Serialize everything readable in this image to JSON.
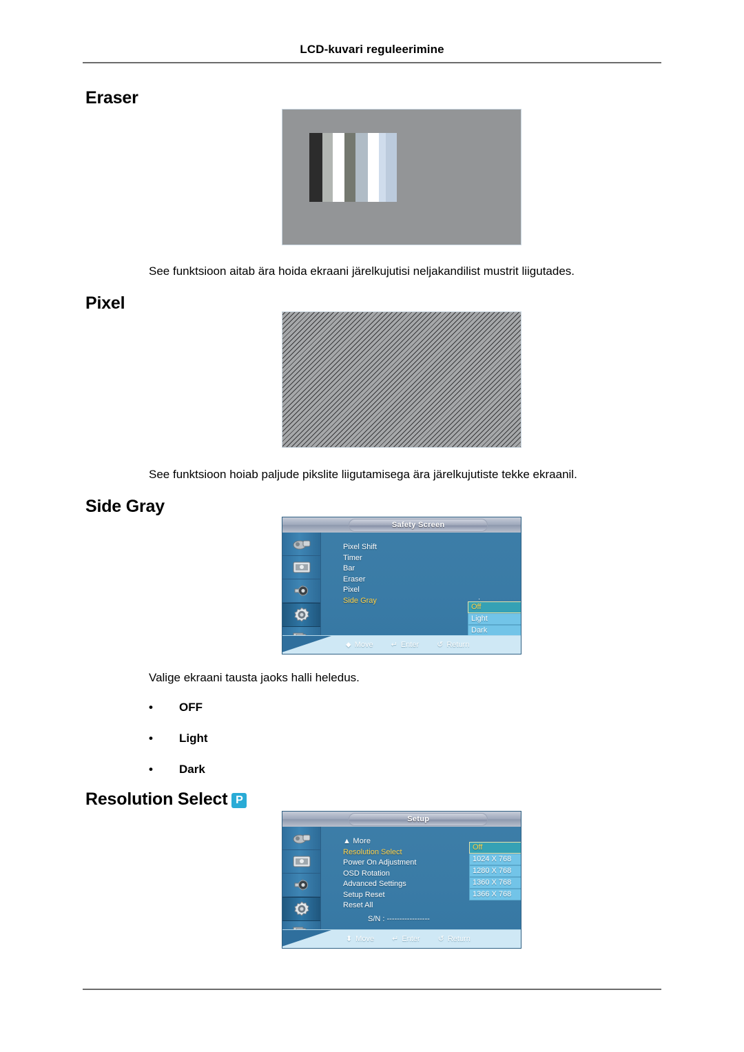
{
  "header": {
    "running_title": "LCD-kuvari reguleerimine"
  },
  "sections": {
    "eraser": {
      "title": "Eraser",
      "description": "See funktsioon aitab ära hoida ekraani järelkujutisi neljakandilist mustrit liigutades.",
      "figure": {
        "name": "eraser-pattern-image",
        "background_color": "#939597",
        "bar_colors": [
          "#2c2c2c",
          "#b2b6b2",
          "#ffffff",
          "#74786f",
          "#b0bcc6",
          "#ffffff",
          "#cfdcec",
          "#bccbdd"
        ]
      }
    },
    "pixel": {
      "title": "Pixel",
      "description": "See funktsioon hoiab paljude pikslite liigutamisega ära järelkujutiste tekke ekraanil.",
      "figure": {
        "name": "pixel-pattern-image",
        "background_color": "#a6a8aa",
        "hatch_color": "#323234"
      }
    },
    "side_gray": {
      "title": "Side Gray",
      "description": "Valige ekraani tausta jaoks halli heledus.",
      "bullets": [
        "OFF",
        "Light",
        "Dark"
      ],
      "osd": {
        "name": "safety-screen-osd",
        "title": "Safety Screen",
        "menu_items": [
          {
            "label": "Pixel Shift",
            "active": false,
            "colon": false
          },
          {
            "label": "Timer",
            "active": false,
            "colon": false
          },
          {
            "label": "Bar",
            "active": false,
            "colon": false
          },
          {
            "label": "Eraser",
            "active": false,
            "colon": false
          },
          {
            "label": "Pixel",
            "active": false,
            "colon": false
          },
          {
            "label": "Side Gray",
            "active": true,
            "colon": true
          }
        ],
        "dropdown": {
          "options": [
            "Off",
            "Light",
            "Dark"
          ],
          "selected": "Off"
        },
        "hints": [
          {
            "icon": "move-icon",
            "glyph": "⬥",
            "label": "Move"
          },
          {
            "icon": "enter-icon",
            "glyph": "↵",
            "label": "Enter"
          },
          {
            "icon": "return-icon",
            "glyph": "↺",
            "label": "Return"
          }
        ],
        "sidebar_icons": [
          "input-source-icon",
          "picture-icon",
          "sound-icon",
          "setup-gear-icon",
          "multi-control-icon"
        ],
        "selected_sidebar_index": 3
      }
    },
    "resolution_select": {
      "title": "Resolution Select",
      "badge": "P",
      "badge_color": "#29abd6",
      "osd": {
        "name": "setup-osd",
        "title": "Setup",
        "menu_items": [
          {
            "label": "▲ More",
            "active": false,
            "colon": false
          },
          {
            "label": "Resolution Select",
            "active": true,
            "colon": true
          },
          {
            "label": "Power On Adjustment",
            "active": false,
            "colon": false
          },
          {
            "label": "OSD Rotation",
            "active": false,
            "colon": true
          },
          {
            "label": "Advanced Settings",
            "active": false,
            "colon": false
          },
          {
            "label": "Setup Reset",
            "active": false,
            "colon": false
          },
          {
            "label": "Reset All",
            "active": false,
            "colon": false
          }
        ],
        "serial_label": "S/N : -----------------",
        "dropdown": {
          "options": [
            "Off",
            "1024 X 768",
            "1280 X 768",
            "1360 X 768",
            "1366 X 768"
          ],
          "selected": "Off"
        },
        "hints": [
          {
            "icon": "move-icon",
            "glyph": "⬍",
            "label": "Move"
          },
          {
            "icon": "enter-icon",
            "glyph": "↵",
            "label": "Enter"
          },
          {
            "icon": "return-icon",
            "glyph": "↺",
            "label": "Return"
          }
        ],
        "sidebar_icons": [
          "input-source-icon",
          "picture-icon",
          "sound-icon",
          "setup-gear-icon",
          "multi-control-icon"
        ],
        "selected_sidebar_index": 3
      }
    }
  }
}
